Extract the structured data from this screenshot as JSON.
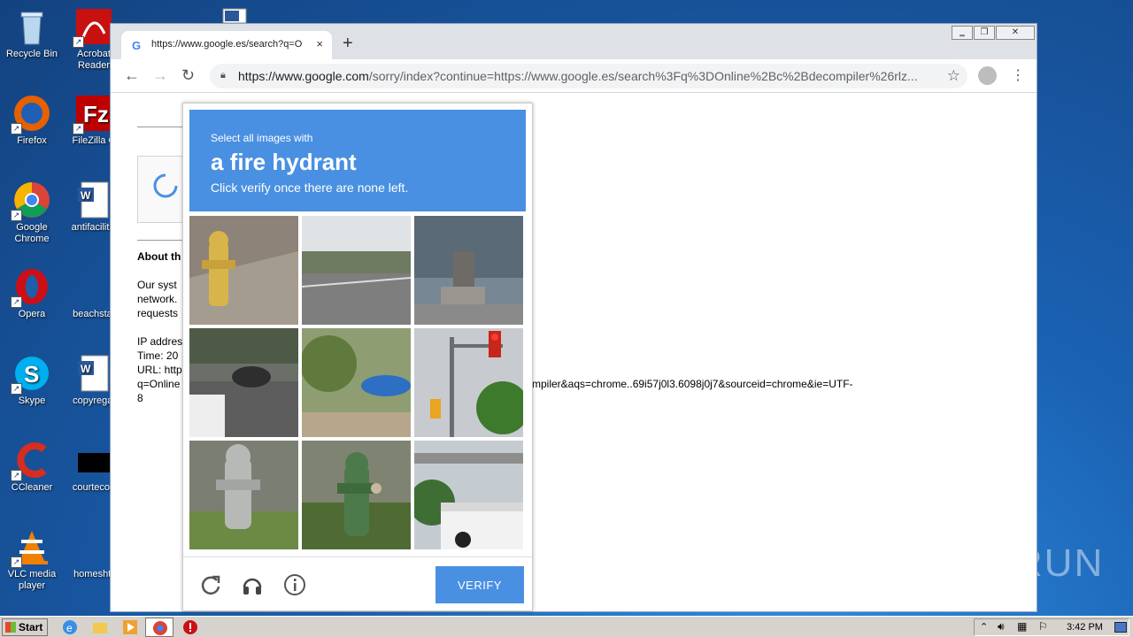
{
  "desktop": {
    "icons": [
      {
        "label": "Recycle Bin"
      },
      {
        "label": "Acrobat Reader"
      },
      {
        "label": "Firefox"
      },
      {
        "label": "FileZilla C"
      },
      {
        "label": "Google Chrome"
      },
      {
        "label": "antifacilitic"
      },
      {
        "label": "Opera"
      },
      {
        "label": "beachstat"
      },
      {
        "label": "Skype"
      },
      {
        "label": "copyregal"
      },
      {
        "label": "CCleaner"
      },
      {
        "label": "courtecon"
      },
      {
        "label": "VLC media player"
      },
      {
        "label": "homeshtr"
      }
    ]
  },
  "browser": {
    "tab_title": "https://www.google.es/search?q=O",
    "tab_close": "×",
    "new_tab": "+",
    "url_host": "https://www.google.com",
    "url_path": "/sorry/index?continue=https://www.google.es/search%3Fq%3DOnline%2Bc%2Bdecompiler%26rlz...",
    "back": "←",
    "forward": "→",
    "reload": "↻",
    "menu": "⋮",
    "star": "☆",
    "window_controls": [
      "‗",
      "❐",
      "✕"
    ]
  },
  "page": {
    "about_heading": "About th",
    "para": [
      "Our syst",
      "network.",
      "requests"
    ],
    "ip_label": "IP addres",
    "time_label": "Time: 20",
    "url_label": "URL: http",
    "url_cont": "q=Online",
    "url_tail": "mpiler&aqs=chrome..69i57j0l3.6098j0j7&sourceid=chrome&ie=UTF-",
    "url_end": "8"
  },
  "captcha": {
    "instruction_small": "Select all images with",
    "target": "a fire hydrant",
    "instruction_sub": "Click verify once there are none left.",
    "verify_label": "VERIFY",
    "reload_icon": "reload-icon",
    "audio_icon": "headphones-icon",
    "info_icon": "info-icon",
    "tiles": [
      "fire hydrant",
      "road",
      "statue",
      "street",
      "car",
      "traffic light",
      "fire hydrant",
      "fire hydrant",
      "truck"
    ]
  },
  "watermark": "ANY RUN",
  "taskbar": {
    "start_label": "Start",
    "clock": "3:42 PM"
  }
}
